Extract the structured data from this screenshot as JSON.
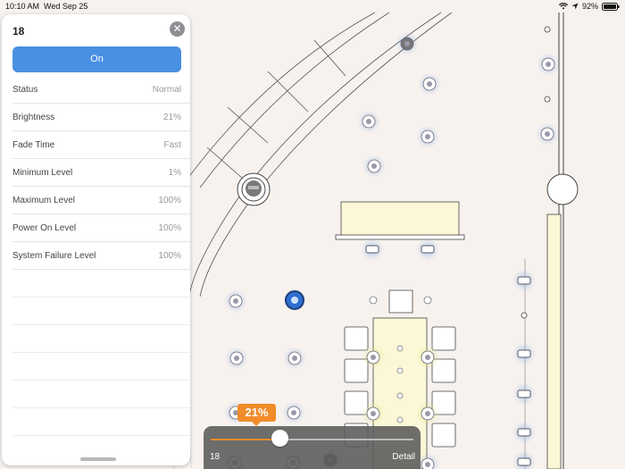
{
  "status_bar": {
    "time": "10:10 AM",
    "date": "Wed Sep 25",
    "battery": "92%"
  },
  "panel": {
    "title": "18",
    "on_button": "On",
    "rows": [
      {
        "label": "Status",
        "value": "Normal"
      },
      {
        "label": "Brightness",
        "value": "21%"
      },
      {
        "label": "Fade Time",
        "value": "Fast"
      },
      {
        "label": "Minimum Level",
        "value": "1%"
      },
      {
        "label": "Maximum Level",
        "value": "100%"
      },
      {
        "label": "Power On Level",
        "value": "100%"
      },
      {
        "label": "System Failure Level",
        "value": "100%"
      }
    ]
  },
  "slider": {
    "percent_label": "21%",
    "level_fraction": 0.21,
    "fixture_id": "18",
    "detail_label": "Detail",
    "accent": "#f08c2a"
  },
  "colors": {
    "primary": "#4a90e2",
    "background": "#f7f2ee",
    "table": "#fbf7d7"
  }
}
